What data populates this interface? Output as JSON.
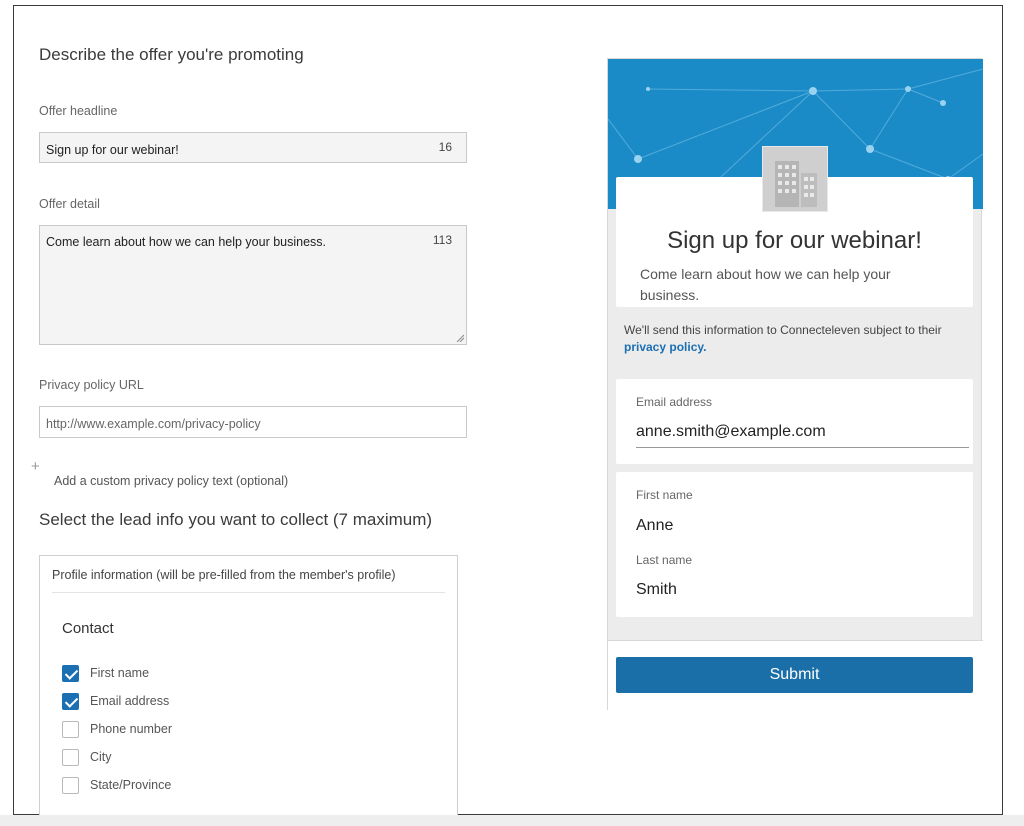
{
  "form": {
    "section_title": "Describe the offer you're promoting",
    "headline": {
      "label": "Offer headline",
      "value": "Sign up for our webinar!",
      "count": "16"
    },
    "detail": {
      "label": "Offer detail",
      "value": "Come learn about how we can help your business.",
      "count": "113"
    },
    "privacy": {
      "label": "Privacy policy URL",
      "placeholder": "http://www.example.com/privacy-policy"
    },
    "custom_privacy_link": "Add a custom privacy policy text (optional)",
    "lead_title": "Select the lead info you want to collect (7 maximum)",
    "lead_box": {
      "subtitle": "Profile information (will be pre-filled from the member's profile)",
      "category": "Contact",
      "options": [
        {
          "label": "First name",
          "checked": true
        },
        {
          "label": "Email address",
          "checked": true
        },
        {
          "label": "Phone number",
          "checked": false
        },
        {
          "label": "City",
          "checked": false
        },
        {
          "label": "State/Province",
          "checked": false
        }
      ]
    }
  },
  "preview": {
    "banner_color": "#1b8bc7",
    "logo_icon": "building-icon",
    "title": "Sign up for our webinar!",
    "detail": "Come learn about how we can help your business.",
    "notice_text": "We'll send this information to Connecteleven subject to their",
    "notice_link": "privacy policy.",
    "email_label": "Email address",
    "email_value": "anne.smith@example.com",
    "first_name_label": "First name",
    "first_name_value": "Anne",
    "last_name_label": "Last name",
    "last_name_value": "Smith",
    "submit_label": "Submit",
    "accent_color": "#1b6fa8"
  }
}
